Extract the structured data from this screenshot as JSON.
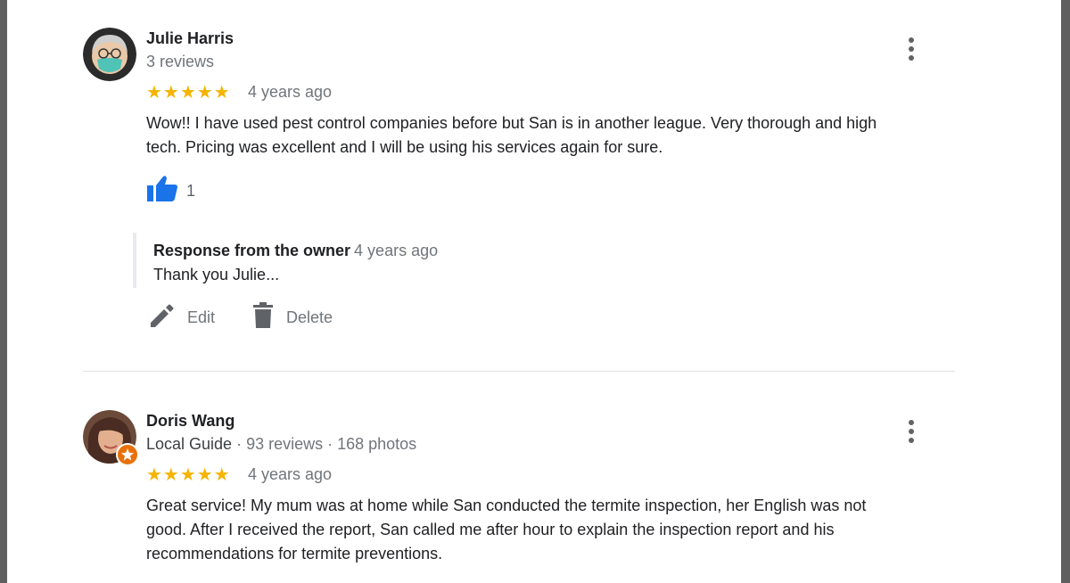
{
  "reviews": [
    {
      "name": "Julie Harris",
      "reviews_count": "3 reviews",
      "stars": "★★★★★",
      "age": "4 years ago",
      "text_lines": [
        "Wow!!  I have used pest control companies before but San is in another league. Very thorough and high",
        "tech. Pricing was excellent and I will be using his services again for sure."
      ],
      "likes": "1",
      "response": {
        "title": "Response from the owner",
        "age": "4 years ago",
        "text": "Thank you Julie..."
      },
      "actions": {
        "edit": "Edit",
        "delete": "Delete"
      }
    },
    {
      "name": "Doris Wang",
      "guide": "Local Guide",
      "reviews_count": " · 93 reviews · 168 photos",
      "stars": "★★★★★",
      "age": "4 years ago",
      "text_lines": [
        "Great service! My mum was at home while San conducted the termite inspection, her English was not",
        "good. After I received the report, San called me after hour to explain the inspection report and his",
        "recommendations for termite preventions."
      ]
    }
  ],
  "colors": {
    "star": "#f5b400",
    "like": "#1a73e8",
    "muted": "#70757a",
    "badge": "#e8710a"
  },
  "icons": [
    "more-vert-icon",
    "thumb-up-icon",
    "pencil-icon",
    "trash-icon",
    "local-guide-star-icon"
  ]
}
